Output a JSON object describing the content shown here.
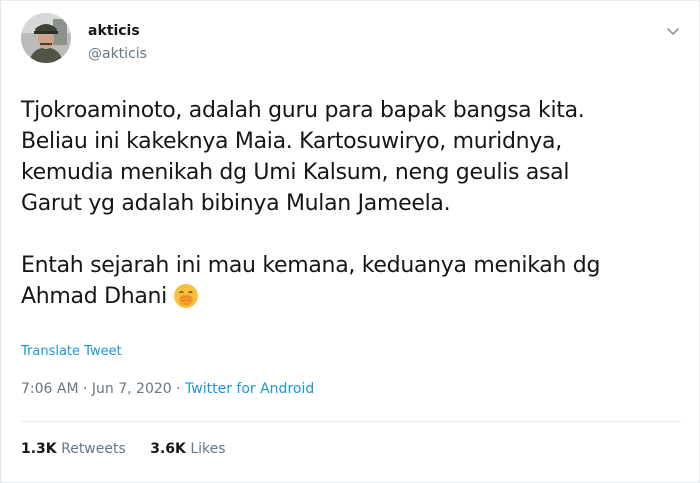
{
  "user": {
    "display_name": "akticis",
    "handle": "@akticis",
    "avatar_icon": "avatar-portrait-icon"
  },
  "menu": {
    "icon": "chevron-down-icon"
  },
  "tweet": {
    "lines": [
      "Tjokroaminoto, adalah guru para bapak bangsa kita.",
      "Beliau ini kakeknya Maia. Kartosuwiryo, muridnya,",
      "kemudia menikah dg Umi Kalsum, neng geulis asal",
      "Garut yg adalah bibinya Mulan Jameela.",
      "Entah sejarah ini mau kemana, keduanya menikah dg",
      "Ahmad Dhani"
    ],
    "emoji_icon": "face-with-hand-over-mouth-emoji"
  },
  "translate_label": "Translate Tweet",
  "meta": {
    "time": "7:06 AM",
    "separator1": " · ",
    "date": "Jun 7, 2020",
    "separator2": " · ",
    "source": "Twitter for Android"
  },
  "stats": {
    "retweets_count": "1.3K",
    "retweets_label": "Retweets",
    "likes_count": "3.6K",
    "likes_label": "Likes"
  },
  "colors": {
    "link": "#1b95e0",
    "secondary_text": "#657786",
    "primary_text": "#14171a",
    "divider": "#e6ecf0"
  }
}
